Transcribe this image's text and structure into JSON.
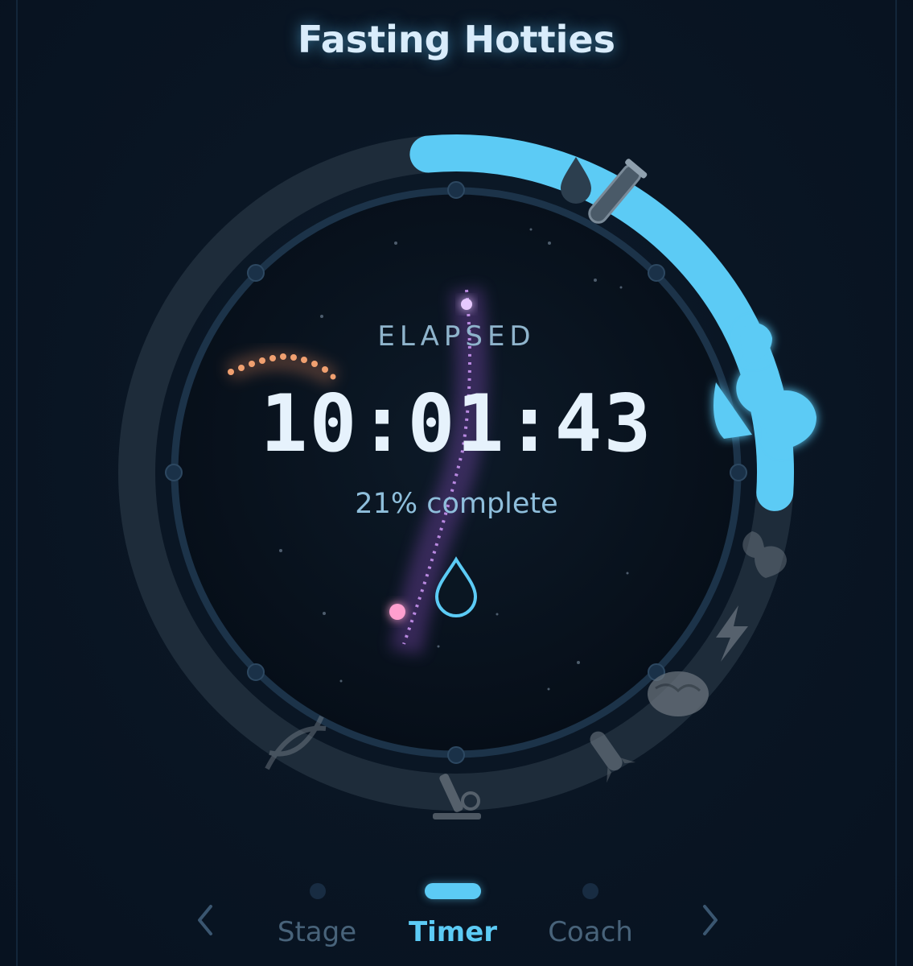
{
  "header": {
    "title": "Fasting Hotties"
  },
  "timer": {
    "label": "ELAPSED",
    "time": "10:01:43",
    "percent_text": "21% complete",
    "progress_fraction": 0.21
  },
  "ring": {
    "stage_icons": [
      "water-drop-icon",
      "test-tube-icon",
      "flexed-biceps-icon",
      "lightning-icon",
      "brain-icon",
      "rocket-icon",
      "microscope-icon",
      "dna-icon"
    ],
    "active_stage_icon": "flexed-biceps-icon",
    "center_icon": "water-drop-icon"
  },
  "tabs": [
    {
      "label": "Stage",
      "active": false
    },
    {
      "label": "Timer",
      "active": true
    },
    {
      "label": "Coach",
      "active": false
    }
  ],
  "nav": {
    "prev_icon": "chevron-left-icon",
    "next_icon": "chevron-right-icon"
  },
  "colors": {
    "accent": "#5ccbf5",
    "background": "#08131f",
    "track": "#1e2c3a",
    "text": "#e6f2fc"
  }
}
